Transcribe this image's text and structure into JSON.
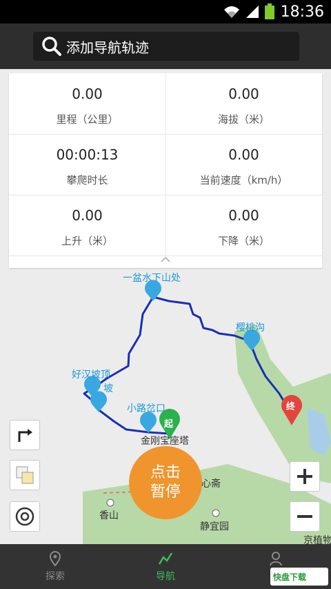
{
  "status_bar": {
    "time": "18:36",
    "icons": [
      "wifi-icon",
      "signal-icon",
      "battery-icon"
    ]
  },
  "search": {
    "placeholder": "添加导航轨迹"
  },
  "stats": [
    {
      "value": "0.00",
      "label": "里程（公里）"
    },
    {
      "value": "0.00",
      "label": "海拔（米）"
    },
    {
      "value": "00:00:13",
      "label": "攀爬时长"
    },
    {
      "value": "0.00",
      "label": "当前速度（km/h）"
    },
    {
      "value": "0.00",
      "label": "上升（米）"
    },
    {
      "value": "0.00",
      "label": "下降（米）"
    }
  ],
  "map": {
    "waypoints": [
      "一盆水下山处",
      "樱桃沟",
      "好汉坡顶",
      "坡",
      "小路岔口"
    ],
    "start_marker": "起",
    "end_marker": "终",
    "places": [
      "金刚宝座塔",
      "心斋",
      "香山",
      "静宜园",
      "京植物"
    ],
    "colors": {
      "track": "#1a2fb5",
      "waypoint": "#3aa8e0",
      "start": "#2bb24c",
      "end": "#e2453c",
      "park": "#b7d9a7"
    }
  },
  "main_button": {
    "line1": "点击",
    "line2": "暂停"
  },
  "tabs": [
    {
      "label": "探索",
      "icon": "location-pin-icon",
      "active": false
    },
    {
      "label": "导航",
      "icon": "route-icon",
      "active": true
    },
    {
      "label": "我",
      "icon": "person-icon",
      "active": false
    }
  ],
  "watermark": {
    "text": "快盘下载"
  }
}
